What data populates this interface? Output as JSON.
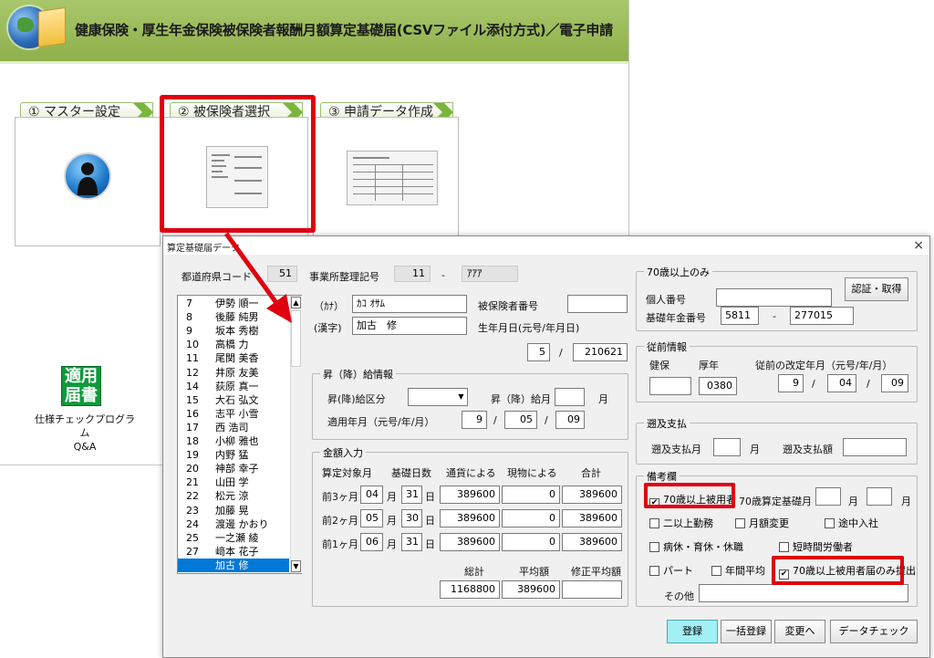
{
  "app": {
    "title": "健康保険・厚生年金保険被保険者報酬月額算定基礎届(CSVファイル添付方式)／電子申請"
  },
  "steps": [
    {
      "label": "① マスター設定"
    },
    {
      "label": "② 被保険者選択"
    },
    {
      "label": "③ 申請データ作成"
    }
  ],
  "tools": {
    "tekiyo_icon": "適用届書",
    "check_line1": "仕様チェックプログラム",
    "check_line2": "Q&A"
  },
  "dialog": {
    "title": "算定基礎届データ",
    "close": "×",
    "pref_label": "都道府県コード",
    "pref_code": "51",
    "office_label": "事業所整理記号",
    "office_code1": "11",
    "office_dash": "-",
    "office_code2": "ｱｱｱ",
    "employees": [
      {
        "no": "7",
        "name": "伊勢 順一"
      },
      {
        "no": "8",
        "name": "後藤 純男"
      },
      {
        "no": "9",
        "name": "坂本 秀樹"
      },
      {
        "no": "10",
        "name": "高橋 力"
      },
      {
        "no": "11",
        "name": "尾関 美香"
      },
      {
        "no": "12",
        "name": "井原 友美"
      },
      {
        "no": "14",
        "name": "荻原 真一"
      },
      {
        "no": "15",
        "name": "大石 弘文"
      },
      {
        "no": "16",
        "name": "志平 小雪"
      },
      {
        "no": "17",
        "name": "西 浩司"
      },
      {
        "no": "18",
        "name": "小柳 雅也"
      },
      {
        "no": "19",
        "name": "内野 猛"
      },
      {
        "no": "20",
        "name": "神部 幸子"
      },
      {
        "no": "21",
        "name": "山田 学"
      },
      {
        "no": "22",
        "name": "松元 涼"
      },
      {
        "no": "23",
        "name": "加藤 晃"
      },
      {
        "no": "24",
        "name": "渡邊 かおり"
      },
      {
        "no": "25",
        "name": "一之瀬 綾"
      },
      {
        "no": "27",
        "name": "﨑本 花子"
      },
      {
        "no": "",
        "name": "加古 修"
      }
    ],
    "person": {
      "kana_label": "（ｶﾅ）",
      "kana": "ｶｺ ｵｻﾑ",
      "kanji_label": "(漢字)",
      "kanji": "加古　修",
      "insured_no_label": "被保険者番号",
      "insured_no": "",
      "birth_label": "生年月日(元号/年月日)",
      "birth_era": "5",
      "birth_sep": "/",
      "birth_date": "210621"
    },
    "raise": {
      "legend": "昇（降）給情報",
      "kubun_label": "昇(降)給区分",
      "kubun_value": "",
      "month_label": "昇（降）給月",
      "month_value": "",
      "month_unit": "月",
      "apply_label": "適用年月（元号/年/月）",
      "apply_era": "9",
      "apply_year": "05",
      "apply_month": "09",
      "sep": "/"
    },
    "amount": {
      "legend": "金額入力",
      "col_month": "算定対象月",
      "col_days": "基礎日数",
      "col_cash": "通貨による",
      "col_kind": "現物による",
      "col_total": "合計",
      "month_unit": "月",
      "day_unit": "日",
      "rows": [
        {
          "label": "前3ヶ月",
          "month": "04",
          "days": "31",
          "cash": "389600",
          "kind": "0",
          "total": "389600"
        },
        {
          "label": "前2ヶ月",
          "month": "05",
          "days": "30",
          "cash": "389600",
          "kind": "0",
          "total": "389600"
        },
        {
          "label": "前1ヶ月",
          "month": "06",
          "days": "31",
          "cash": "389600",
          "kind": "0",
          "total": "389600"
        }
      ],
      "sum_label": "総計",
      "avg_label": "平均額",
      "mod_label": "修正平均額",
      "sum_value": "1168800",
      "avg_value": "389600",
      "mod_value": ""
    },
    "over70": {
      "legend": "70歳以上のみ",
      "mynumber_label": "個人番号",
      "mynumber": "",
      "auth_button": "認証・取得",
      "pension_label": "基礎年金番号",
      "pension1": "5811",
      "pension_dash": "-",
      "pension2": "277015"
    },
    "previous": {
      "legend": "従前情報",
      "kenpo_label": "健保",
      "kosei_label": "厚年",
      "kenpo": "",
      "kosei": "0380",
      "revised_label": "従前の改定年月（元号/年/月）",
      "era": "9",
      "year": "04",
      "month": "09",
      "sep": "/"
    },
    "retro": {
      "legend": "遡及支払",
      "month_label": "遡及支払月",
      "month_value": "",
      "month_unit": "月",
      "amount_label": "遡及支払額",
      "amount_value": ""
    },
    "remarks": {
      "legend": "備考欄",
      "over70_label": "70歳以上被用者",
      "over70_checked": "✔",
      "over70_month_label": "70歳算定基礎月",
      "m1": "",
      "m2": "",
      "month_unit": "月",
      "nijo": "二以上勤務",
      "getsugaku": "月額変更",
      "tochu": "途中入社",
      "byokyu": "病休・育休・休職",
      "tanjikan": "短時間労働者",
      "part": "パート",
      "nenkan": "年間平均",
      "only70": "70歳以上被用者届のみ提出",
      "only70_checked": "✔",
      "other_label": "その他",
      "other_value": ""
    },
    "buttons": {
      "register": "登録",
      "bulk": "一括登録",
      "change": "変更へ",
      "check": "データチェック"
    }
  },
  "colors": {
    "banner": "#9bbb59",
    "highlight": "#e0000f",
    "selected": "#0078d7",
    "register_btn": "#a3f0f5"
  }
}
